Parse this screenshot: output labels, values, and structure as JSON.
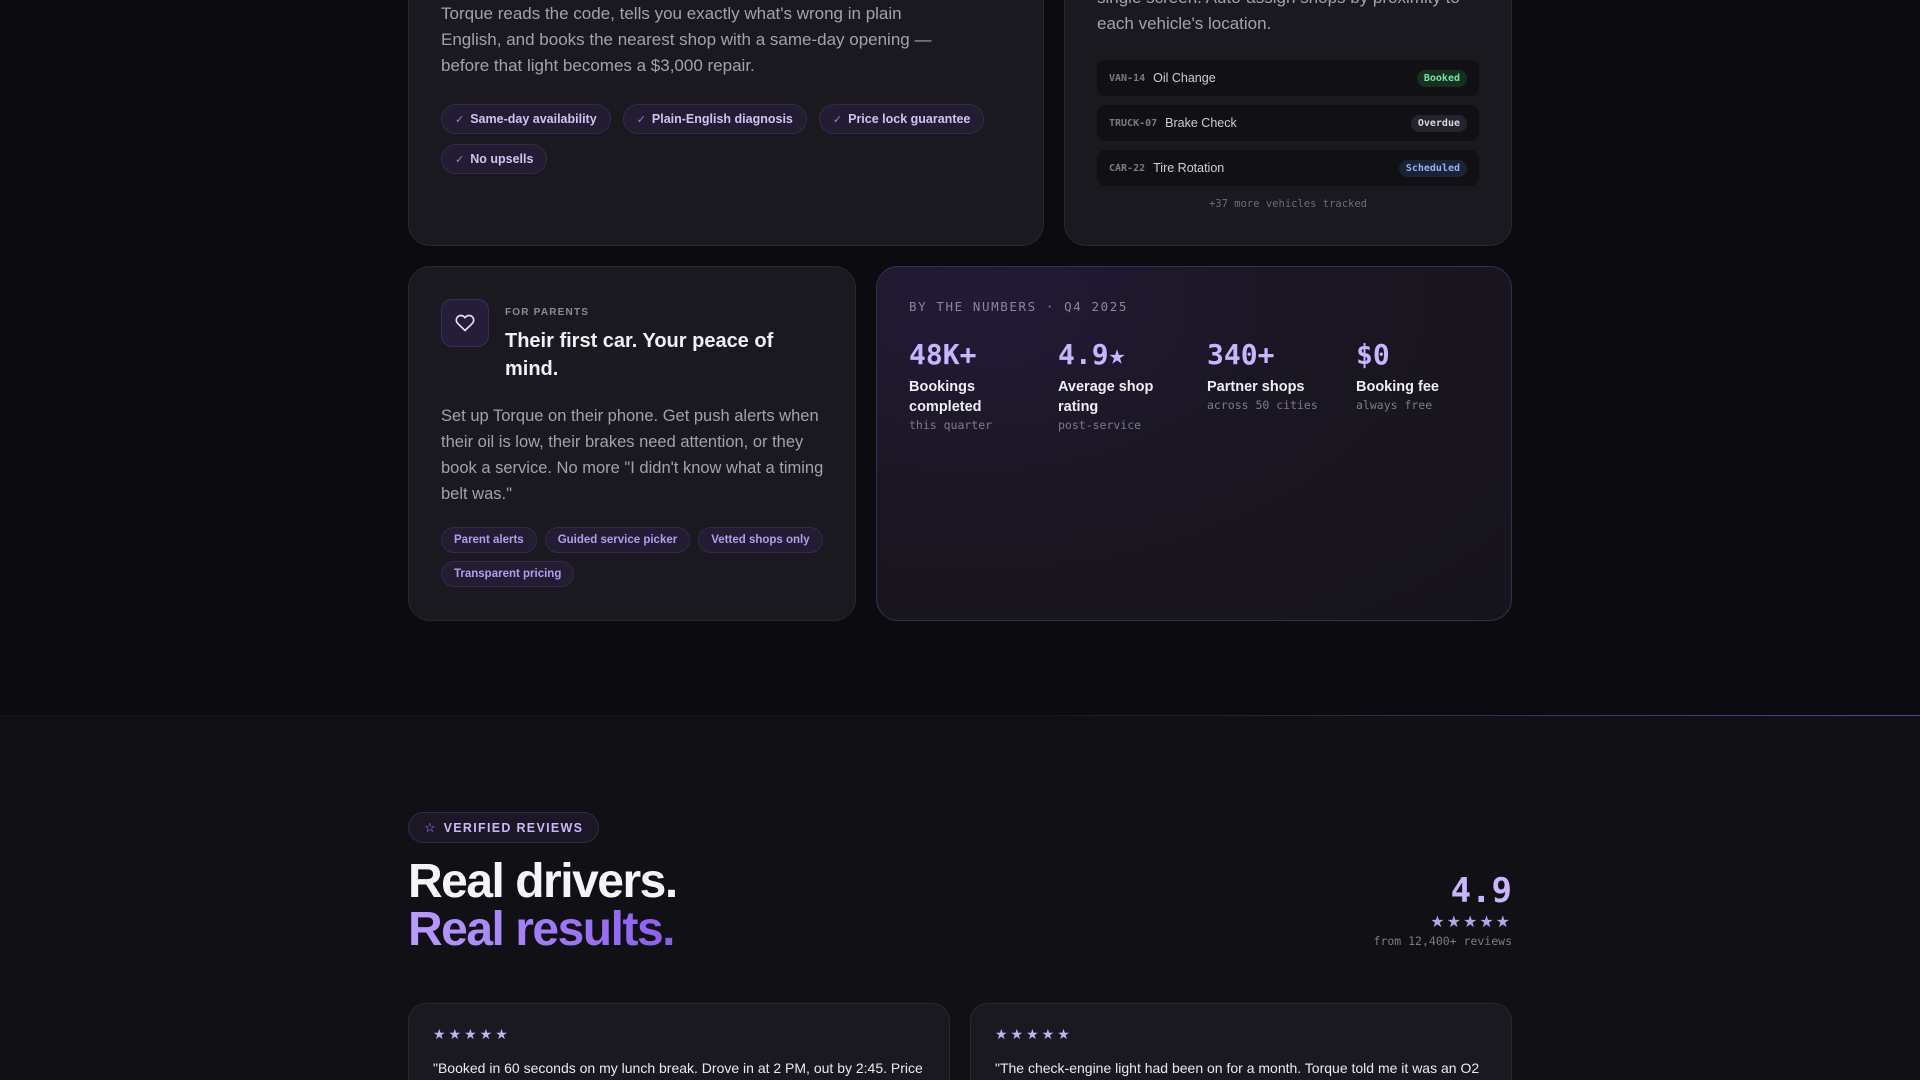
{
  "driver_card": {
    "description": "Torque reads the code, tells you exactly what's wrong in plain English, and books the nearest shop with a same-day opening — before that light becomes a $3,000 repair.",
    "chips": [
      "Same-day availability",
      "Plain-English diagnosis",
      "Price lock guarantee",
      "No upsells"
    ]
  },
  "fleet_card": {
    "description": "single screen. Auto-assign shops by proximity to each vehicle's location.",
    "rows": [
      {
        "vehicle": "VAN-14",
        "service": "Oil Change",
        "status": "Booked"
      },
      {
        "vehicle": "TRUCK-07",
        "service": "Brake Check",
        "status": "Overdue"
      },
      {
        "vehicle": "CAR-22",
        "service": "Tire Rotation",
        "status": "Scheduled"
      }
    ],
    "more": "+37 more vehicles tracked"
  },
  "parents_card": {
    "icon": "heart-icon",
    "eyebrow": "FOR PARENTS",
    "title": "Their first car. Your peace of mind.",
    "description": "Set up Torque on their phone. Get push alerts when their oil is low, their brakes need attention, or they book a service. No more \"I didn't know what a timing belt was.\"",
    "chips": [
      "Parent alerts",
      "Guided service picker",
      "Vetted shops only",
      "Transparent pricing"
    ]
  },
  "numbers_card": {
    "eyebrow": "BY THE NUMBERS · Q4 2025",
    "stats": [
      {
        "value": "48K+",
        "label": "Bookings completed",
        "sub": "this quarter"
      },
      {
        "value": "4.9★",
        "label": "Average shop rating",
        "sub": "post-service"
      },
      {
        "value": "340+",
        "label": "Partner shops",
        "sub": "across 50 cities"
      },
      {
        "value": "$0",
        "label": "Booking fee",
        "sub": "always free"
      }
    ]
  },
  "reviews": {
    "pill_label": "VERIFIED REVIEWS",
    "headline_line1": "Real drivers.",
    "headline_line2": "Real results.",
    "rating": "4.9",
    "rating_stars": "★★★★★",
    "rating_sub": "from 12,400+ reviews",
    "cards": [
      {
        "stars": "★★★★★",
        "text": "\"Booked in 60 seconds on my lunch break. Drove in at 2 PM, out by 2:45. Price"
      },
      {
        "stars": "★★★★★",
        "text": "\"The check-engine light had been on for a month. Torque told me it was an O2"
      }
    ]
  },
  "colors": {
    "accent": "#c9b4ff",
    "background": "#0c0b0f",
    "card": "#1a1920"
  }
}
